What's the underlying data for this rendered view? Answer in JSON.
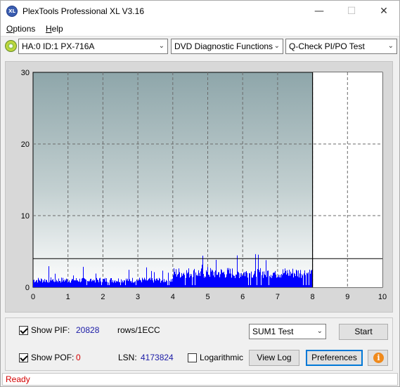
{
  "window": {
    "title": "PlexTools Professional XL V3.16",
    "app_icon_text": "XL",
    "minimize_glyph": "—",
    "maximize_glyph": "☐",
    "close_glyph": "✕"
  },
  "menu": {
    "options_first": "O",
    "options_rest": "ptions",
    "help_first": "H",
    "help_rest": "elp"
  },
  "toolbar": {
    "drive": "HA:0 ID:1  PX-716A",
    "function": "DVD Diagnostic Functions",
    "test": "Q-Check PI/PO Test",
    "dropdown_glyph": "⌄"
  },
  "chart_data": {
    "type": "bar",
    "xlabel": "",
    "ylabel": "",
    "xlim": [
      0,
      10
    ],
    "ylim": [
      0,
      30
    ],
    "x_ticks": [
      "0",
      "1",
      "2",
      "3",
      "4",
      "5",
      "6",
      "7",
      "8",
      "9",
      "10"
    ],
    "y_ticks": [
      "0",
      "10",
      "20",
      "30"
    ],
    "threshold_line": 4,
    "cursor_x": 8.0,
    "data_end_x": 8.0,
    "grid": true,
    "bar_color": "#0000ff",
    "segments": [
      {
        "x_start": 0.0,
        "x_end": 4.0,
        "typical": 1,
        "peak": 3
      },
      {
        "x_start": 4.0,
        "x_end": 8.0,
        "typical": 2,
        "peak": 5
      }
    ]
  },
  "controls": {
    "show_pif_label": "Show PIF:",
    "pif_value": "20828",
    "pif_unit": "rows/1ECC",
    "show_pof_label": "Show POF:",
    "pof_value": "0",
    "lsn_label": "LSN:",
    "lsn_value": "4173824",
    "logarithmic_label": "Logarithmic",
    "sum_select": "SUM1 Test",
    "start_button": "Start",
    "view_log_button": "View Log",
    "preferences_button": "Preferences",
    "info_glyph": "i"
  },
  "status": {
    "text": "Ready"
  }
}
